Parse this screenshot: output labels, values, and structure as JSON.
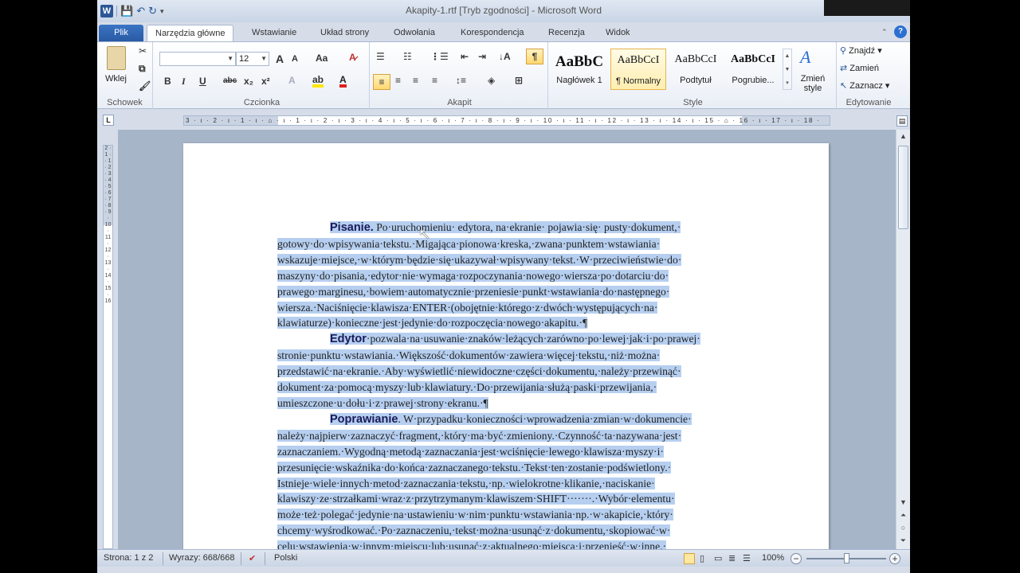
{
  "window": {
    "title": "Akapity-1.rtf [Tryb zgodności] - Microsoft Word"
  },
  "qat": {
    "word_logo": "W",
    "save": "💾",
    "undo": "↶",
    "redo": "↻"
  },
  "tabs": [
    {
      "label": "Plik"
    },
    {
      "label": "Narzędzia główne"
    },
    {
      "label": "Wstawianie"
    },
    {
      "label": "Układ strony"
    },
    {
      "label": "Odwołania"
    },
    {
      "label": "Korespondencja"
    },
    {
      "label": "Recenzja"
    },
    {
      "label": "Widok"
    }
  ],
  "ribbon": {
    "clipboard": {
      "paste_label": "Wklej",
      "group_label": "Schowek"
    },
    "font": {
      "font_name": "",
      "font_size": "12",
      "group_label": "Czcionka",
      "bold": "B",
      "italic": "I",
      "underline": "U",
      "strike": "abc",
      "sub": "x₂",
      "sup": "x²",
      "grow": "A",
      "shrink": "A",
      "case": "Aa"
    },
    "paragraph": {
      "group_label": "Akapit",
      "pilcrow": "¶"
    },
    "styles": {
      "group_label": "Style",
      "items": [
        {
          "sample": "AaBbC",
          "name": "Nagłówek 1"
        },
        {
          "sample": "AaBbCcI",
          "name": "¶ Normalny"
        },
        {
          "sample": "AaBbCcI",
          "name": "Podtytuł"
        },
        {
          "sample": "AaBbCcI",
          "name": "Pogrubie..."
        }
      ],
      "change_styles": "Zmień style"
    },
    "editing": {
      "group_label": "Edytowanie",
      "find": "Znajdź",
      "replace": "Zamień",
      "select": "Zaznacz"
    }
  },
  "ruler": {
    "corner": "L",
    "ticks": "3 · ı · 2 · ı · 1 · ı · ⌂ · ı · 1 · ı · 2 · ı · 3 · ı · 4 · ı · 5 · ı · 6 · ı · 7 · ı · 8 · ı · 9 · ı · 10 · ı · 11 · ı · 12 · ı · 13 · ı · 14 · ı · 15 · ⌂ · 16 · ı · 17 · ı · 18 ·"
  },
  "vruler": {
    "ticks": "2 · 1 · · 1 · 2 · 3 · 4 · 5 · 6 · 7 · 8 · 9 · 10 · 11 · 12 · 13 · 14 · 15 · 16"
  },
  "document": {
    "p1": {
      "head": "Pisanie.",
      "lines": [
        " Po·uruchomieniu· edytora, na·ekranie· pojawia·się· pusty·dokument,·",
        "gotowy·do·wpisywania·tekstu.·Migająca·pionowa·kreska,·zwana·punktem·wstawiania·",
        "wskazuje·miejsce,·w·którym·będzie·się·ukazywał·wpisywany·tekst.·W·przeciwieństwie·do·",
        "maszyny·do·pisania,·edytor·nie·wymaga·rozpoczynania·nowego·wiersza·po·dotarciu·do·",
        "prawego·marginesu,·bowiem·automatycznie·przeniesie·punkt·wstawiania·do·następnego·",
        "wiersza.·Naciśnięcie·klawisza·ENTER·(obojętnie·którego·z·dwóch·występujących·na·",
        "klawiaturze)·konieczne·jest·jedynie·do·rozpoczęcia·nowego·akapitu.·¶"
      ]
    },
    "p2": {
      "head": "Edytor",
      "lines": [
        "·pozwala·na·usuwanie·znaków·leżących·zarówno·po·lewej·jak·i·po·prawej·",
        "stronie·punktu·wstawiania.·Większość·dokumentów·zawiera·więcej·tekstu,·niż·można·",
        "przedstawić·na·ekranie.·Aby·wyświetlić·niewidoczne·części·dokumentu,·należy·przewinąć·",
        "dokument·za·pomocą·myszy·lub·klawiatury.·Do·przewijania·służą·paski·przewijania,·",
        "umieszczone·u·dołu·i·z·prawej·strony·ekranu.·¶"
      ]
    },
    "p3": {
      "head": "Poprawianie",
      "lines": [
        ". W·przypadku·konieczności·wprowadzenia·zmian·w·dokumencie·",
        "należy·najpierw·zaznaczyć·fragment,·który·ma·być·zmieniony.·Czynność·ta·nazywana·jest·",
        "zaznaczaniem.·Wygodną·metodą·zaznaczania·jest·wciśnięcie·lewego·klawisza·myszy·i·",
        "przesunięcie·wskaźnika·do·końca·zaznaczanego·tekstu.·Tekst·ten·zostanie·podświetlony.·",
        "Istnieje·wiele·innych·metod·zaznaczania·tekstu,·np.·wielokrotne·klikanie,·naciskanie·",
        "klawiszy·ze·strzałkami·wraz·z·przytrzymanym·klawiszem·SHIFT·······.·Wybór·elementu·",
        "może·też·polegać·jedynie·na·ustawieniu·w·nim·punktu·wstawiania·np.·w·akapicie,·który·",
        "chcemy·wyśrodkować.·Po·zaznaczeniu,·tekst·można·usunąć·z·dokumentu,·skopiować·w·",
        "celu·wstawienia·w·innym·miejscu·lub·usunąć·z·aktualnego·miejsca·i·przenieść·w·inne.·"
      ]
    }
  },
  "status": {
    "page": "Strona: 1 z 2",
    "words": "Wyrazy: 668/668",
    "lang": "Polski",
    "zoom": "100%",
    "zoom_fraction": 0.5
  },
  "colors": {
    "selection": "#b6cff0",
    "accent": "#2b5797"
  }
}
